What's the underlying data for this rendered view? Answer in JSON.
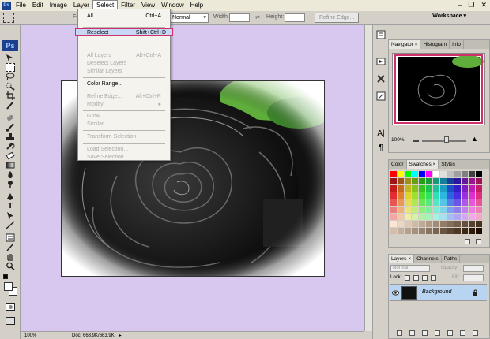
{
  "menubar": {
    "logo": "Ps",
    "items": [
      "File",
      "Edit",
      "Image",
      "Layer",
      "Select",
      "Filter",
      "View",
      "Window",
      "Help"
    ],
    "active_item": "Select"
  },
  "options_bar": {
    "feather_label": "Fe",
    "style_value": "Normal",
    "width_label": "Width:",
    "height_label": "Height:",
    "refine_edge_label": "Refine Edge...",
    "workspace_label": "Workspace"
  },
  "select_menu": {
    "items": [
      {
        "label": "All",
        "shortcut": "Ctrl+A",
        "enabled": true
      },
      {
        "label": "Reselect",
        "shortcut": "Shift+Ctrl+D",
        "enabled": true,
        "highlighted": true
      },
      {
        "label": "All Layers",
        "shortcut": "Alt+Ctrl+A",
        "enabled": false
      },
      {
        "label": "Deselect Layers",
        "shortcut": "",
        "enabled": false
      },
      {
        "label": "Similar Layers",
        "shortcut": "",
        "enabled": false
      },
      {
        "label": "Color Range...",
        "shortcut": "",
        "enabled": true
      },
      {
        "label": "Refine Edge...",
        "shortcut": "Alt+Ctrl+R",
        "enabled": false
      },
      {
        "label": "Modify",
        "shortcut": "",
        "enabled": false,
        "submenu": true
      },
      {
        "label": "Grow",
        "shortcut": "",
        "enabled": false
      },
      {
        "label": "Similar",
        "shortcut": "",
        "enabled": false
      },
      {
        "label": "Transform Selection",
        "shortcut": "",
        "enabled": false
      },
      {
        "label": "Load Selection...",
        "shortcut": "",
        "enabled": false
      },
      {
        "label": "Save Selection...",
        "shortcut": "",
        "enabled": false
      }
    ]
  },
  "toolbox": {
    "logo": "Ps"
  },
  "status": {
    "zoom": "100%",
    "doc": "Doc: 663.9K/663.9K"
  },
  "navigator": {
    "tabs": [
      "Navigator",
      "Histogram",
      "Info"
    ],
    "zoom": "100%"
  },
  "swatches": {
    "tabs": [
      "Color",
      "Swatches",
      "Styles"
    ]
  },
  "layers": {
    "tabs": [
      "Layers",
      "Channels",
      "Paths"
    ],
    "blend_mode": "Normal",
    "opacity_label": "Opacity:",
    "lock_label": "Lock:",
    "fill_label": "Fill:",
    "layer_name": "Background"
  },
  "colors": {
    "canvas_bg": "#d8c8f0",
    "highlight_border": "#d0306a",
    "selected_layer": "#b8d4f0"
  }
}
